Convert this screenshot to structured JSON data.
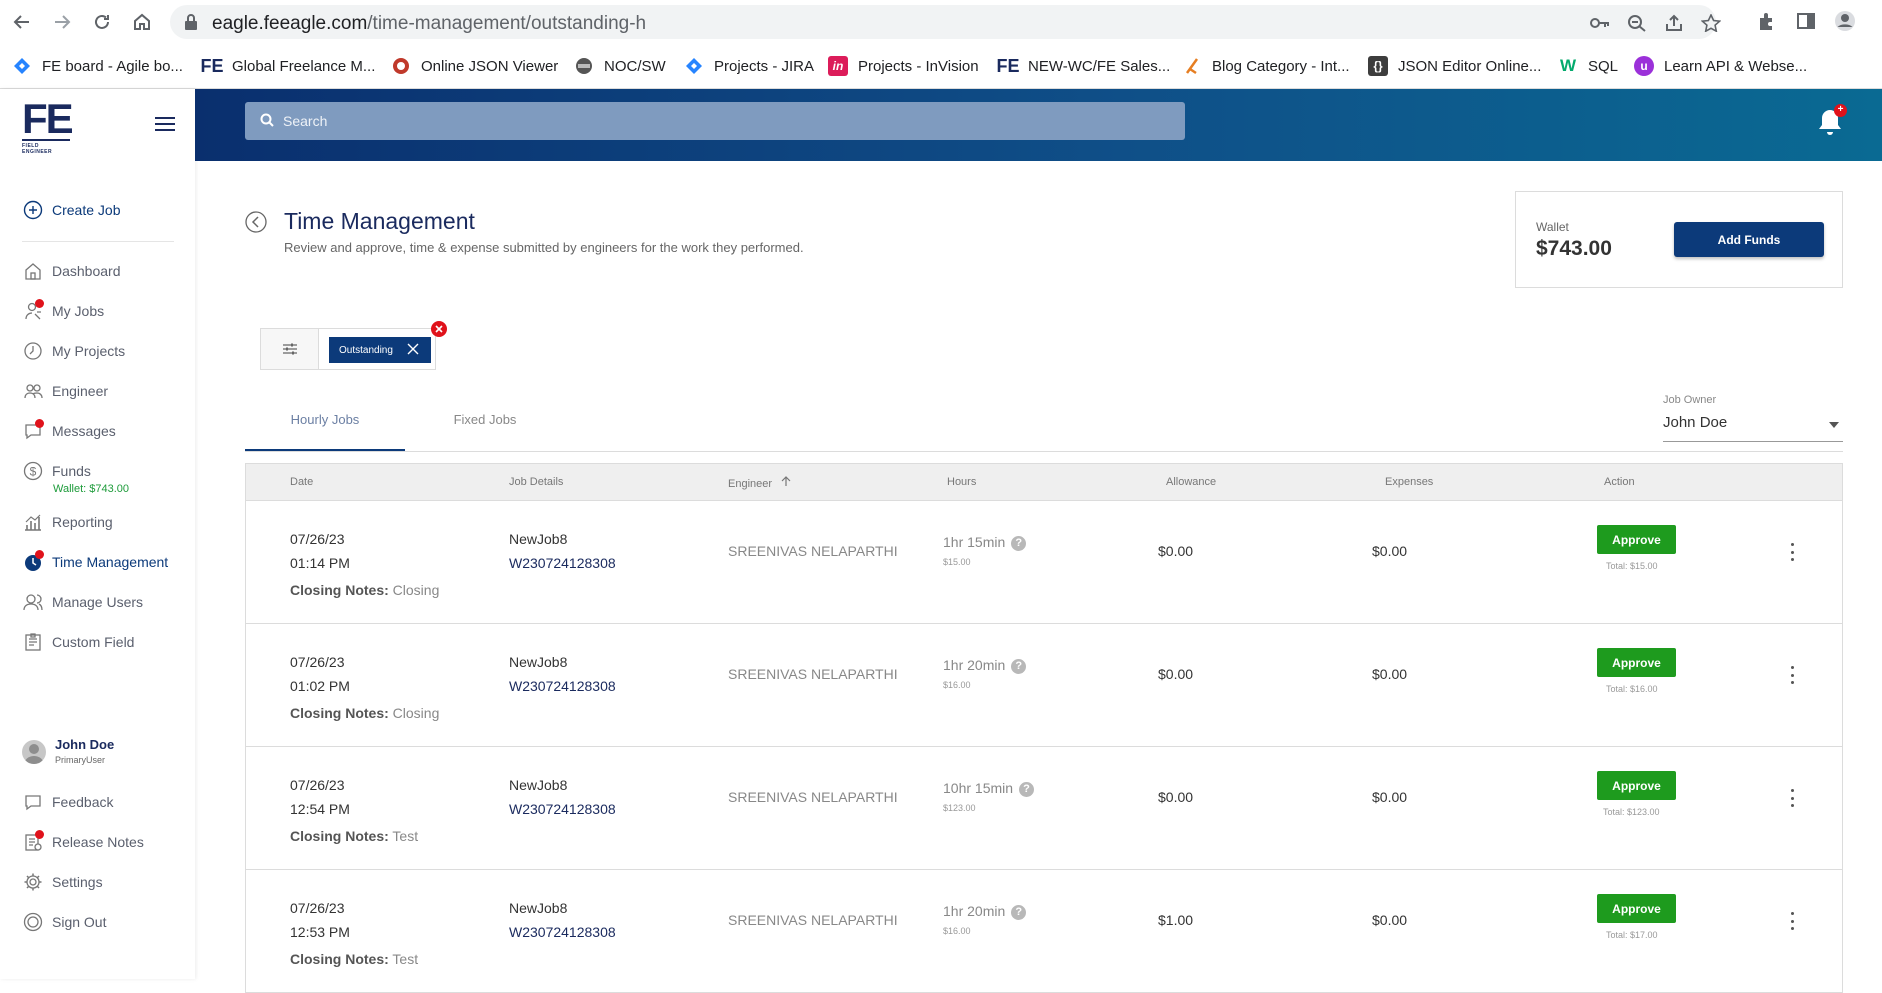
{
  "browser": {
    "url_host": "eagle.feeagle.com",
    "url_path": "/time-management/outstanding-h",
    "bookmarks": [
      {
        "label": "FE board - Agile bo...",
        "icon": "jira-diamond-icon"
      },
      {
        "label": "Global Freelance M...",
        "icon": "fe-logo-icon"
      },
      {
        "label": "Online JSON Viewer",
        "icon": "json-viewer-icon"
      },
      {
        "label": "NOC/SW",
        "icon": "noc-icon"
      },
      {
        "label": "Projects - JIRA",
        "icon": "jira-diamond-icon"
      },
      {
        "label": "Projects - InVision",
        "icon": "invision-icon"
      },
      {
        "label": "NEW-WC/FE Sales...",
        "icon": "fe-logo-icon"
      },
      {
        "label": "Blog Category - Int...",
        "icon": "blog-icon"
      },
      {
        "label": "JSON Editor Online...",
        "icon": "json-editor-icon"
      },
      {
        "label": "SQL",
        "icon": "w3schools-icon"
      },
      {
        "label": "Learn API & Webse...",
        "icon": "learn-api-icon"
      }
    ]
  },
  "sidebar": {
    "logo_text": "FE",
    "logo_sub": "FIELD ENGINEER",
    "create_job": "Create Job",
    "items": [
      {
        "label": "Dashboard",
        "icon": "home-icon",
        "dot": false
      },
      {
        "label": "My Jobs",
        "icon": "jobs-icon",
        "dot": true
      },
      {
        "label": "My Projects",
        "icon": "projects-icon",
        "dot": false
      },
      {
        "label": "Engineer",
        "icon": "engineer-icon",
        "dot": false
      },
      {
        "label": "Messages",
        "icon": "messages-icon",
        "dot": true
      },
      {
        "label": "Funds",
        "icon": "dollar-icon",
        "dot": false
      },
      {
        "label": "Reporting",
        "icon": "reporting-icon",
        "dot": false
      },
      {
        "label": "Time Management",
        "icon": "time-management-icon",
        "dot": true,
        "active": true
      },
      {
        "label": "Manage Users",
        "icon": "users-icon",
        "dot": false
      },
      {
        "label": "Custom Field",
        "icon": "custom-field-icon",
        "dot": false
      }
    ],
    "funds_wallet": "Wallet: $743.00",
    "user": {
      "name": "John Doe",
      "role": "PrimaryUser"
    },
    "bottom_items": [
      {
        "label": "Feedback",
        "icon": "feedback-icon",
        "dot": false
      },
      {
        "label": "Release Notes",
        "icon": "release-notes-icon",
        "dot": true
      },
      {
        "label": "Settings",
        "icon": "gear-icon",
        "dot": false
      },
      {
        "label": "Sign Out",
        "icon": "sign-out-icon",
        "dot": false
      }
    ]
  },
  "topbar": {
    "search_placeholder": "Search",
    "notification_badge": "+"
  },
  "page": {
    "title": "Time Management",
    "subtitle": "Review and approve, time & expense submitted by engineers for the work they performed.",
    "wallet_label": "Wallet",
    "wallet_amount": "$743.00",
    "add_funds": "Add Funds",
    "filter_chip": "Outstanding",
    "tabs": [
      "Hourly Jobs",
      "Fixed Jobs"
    ],
    "active_tab": 0,
    "job_owner_label": "Job Owner",
    "job_owner_value": "John Doe"
  },
  "table": {
    "headers": [
      "Date",
      "Job Details",
      "Engineer",
      "Hours",
      "Allowance",
      "Expenses",
      "Action"
    ],
    "closing_notes_label": "Closing Notes:",
    "approve_label": "Approve",
    "rows": [
      {
        "date": "07/26/23",
        "time": "01:14 PM",
        "notes": "Closing",
        "job": "NewJob8",
        "job_id": "W230724128308",
        "engineer": "SREENIVAS NELAPARTHI",
        "hours": "1hr 15min",
        "rate": "$15.00",
        "allowance": "$0.00",
        "expenses": "$0.00",
        "total": "Total: $15.00"
      },
      {
        "date": "07/26/23",
        "time": "01:02 PM",
        "notes": "Closing",
        "job": "NewJob8",
        "job_id": "W230724128308",
        "engineer": "SREENIVAS NELAPARTHI",
        "hours": "1hr 20min",
        "rate": "$16.00",
        "allowance": "$0.00",
        "expenses": "$0.00",
        "total": "Total: $16.00"
      },
      {
        "date": "07/26/23",
        "time": "12:54 PM",
        "notes": "Test",
        "job": "NewJob8",
        "job_id": "W230724128308",
        "engineer": "SREENIVAS NELAPARTHI",
        "hours": "10hr 15min",
        "rate": "$123.00",
        "allowance": "$0.00",
        "expenses": "$0.00",
        "total": "Total: $123.00"
      },
      {
        "date": "07/26/23",
        "time": "12:53 PM",
        "notes": "Test",
        "job": "NewJob8",
        "job_id": "W230724128308",
        "engineer": "SREENIVAS NELAPARTHI",
        "hours": "1hr 20min",
        "rate": "$16.00",
        "allowance": "$1.00",
        "expenses": "$0.00",
        "total": "Total: $17.00"
      }
    ]
  },
  "colors": {
    "brand_navy": "#0c3a7a",
    "approve_green": "#1e9b1e",
    "alert_red": "#e0121b",
    "wallet_green": "#1d9b3a"
  }
}
